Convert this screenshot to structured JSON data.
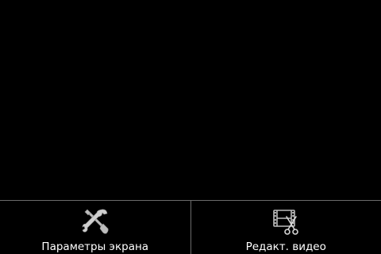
{
  "options_menu": {
    "items": [
      {
        "label": "Параметры экрана",
        "icon": "wrench-screwdriver-icon"
      },
      {
        "label": "Редакт. видео",
        "icon": "film-scissors-icon"
      }
    ]
  },
  "colors": {
    "background": "#000000",
    "divider": "#6b6b6b",
    "icon": "#c8c8c8",
    "label": "#ffffff"
  }
}
